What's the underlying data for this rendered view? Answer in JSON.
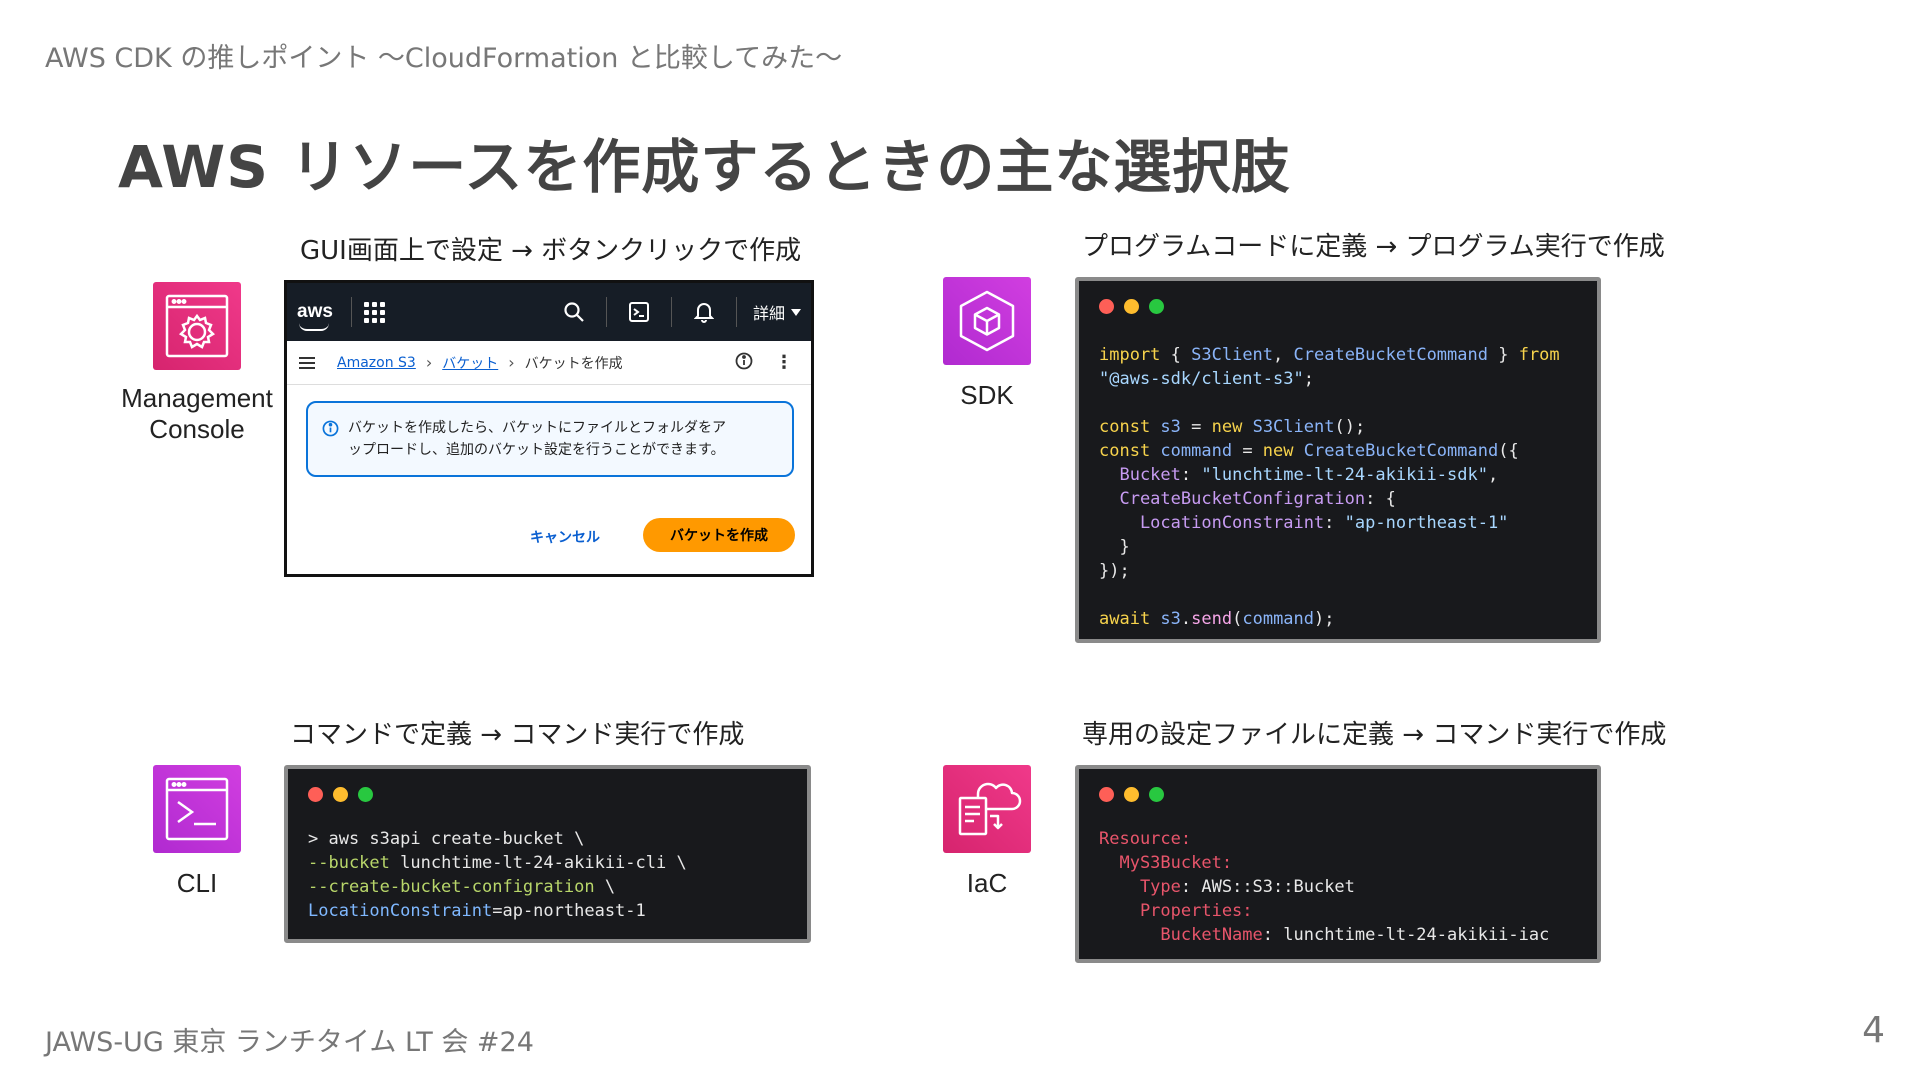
{
  "slide": {
    "header": "AWS CDK の推しポイント 〜CloudFormation と比較してみた〜",
    "title": "AWS リソースを作成するときの主な選択肢",
    "footer": "JAWS-UG 東京 ランチタイム LT 会 #24",
    "page_number": "4"
  },
  "quadrants": {
    "console": {
      "caption": "GUI画面上で設定 → ボタンクリックで作成",
      "label_line1": "Management",
      "label_line2": "Console",
      "icon": "gear-icon",
      "color": "#e7337f"
    },
    "sdk": {
      "caption": "プログラムコードに定義 → プログラム実行で作成",
      "label": "SDK",
      "icon": "cube-icon",
      "color": "#c93ad8"
    },
    "cli": {
      "caption": "コマンドで定義 → コマンド実行で作成",
      "label": "CLI",
      "icon": "terminal-prompt-icon",
      "color": "#c93ad8"
    },
    "iac": {
      "caption": "専用の設定ファイルに定義 → コマンド実行で作成",
      "label": "IaC",
      "icon": "cloud-document-icon",
      "color": "#e7337f"
    }
  },
  "console_mock": {
    "logo": "aws",
    "detail_menu": "詳細",
    "breadcrumb": [
      "Amazon S3",
      "バケット",
      "バケットを作成"
    ],
    "info_line1": "バケットを作成したら、バケットにファイルとフォルダをア",
    "info_line2": "ップロードし、追加のバケット設定を行うことができます。",
    "cancel_label": "キャンセル",
    "create_label": "バケットを作成"
  },
  "sdk_code": {
    "l1_import": "import",
    "l1_open": " { ",
    "l1_cls1": "S3Client",
    "l1_comma": ", ",
    "l1_cls2": "CreateBucketCommand",
    "l1_close": " } ",
    "l1_from": "from",
    "l2_str": "\"@aws-sdk/client-s3\"",
    "l2_semi": ";",
    "l4_const": "const",
    "l4_var": " s3",
    "l4_eq": " = ",
    "l4_new": "new",
    "l4_cls": " S3Client",
    "l4_rest": "();",
    "l5_const": "const",
    "l5_var": " command",
    "l5_eq": " = ",
    "l5_new": "new",
    "l5_cls": " CreateBucketCommand",
    "l5_rest": "({",
    "l6_prop": "  Bucket",
    "l6_colon": ": ",
    "l6_str": "\"lunchtime-lt-24-akikii-sdk\"",
    "l6_comma": ",",
    "l7_prop": "  CreateBucketConfigration",
    "l7_rest": ": {",
    "l8_prop": "    LocationConstraint",
    "l8_colon": ": ",
    "l8_str": "\"ap-northeast-1\"",
    "l9": "  }",
    "l10": "});",
    "l12_await": "await",
    "l12_obj": " s3",
    "l12_dot": ".",
    "l12_fn": "send",
    "l12_open": "(",
    "l12_arg": "command",
    "l12_close": ");"
  },
  "cli_code": {
    "l1": "> aws s3api create-bucket \\",
    "l2_flag": "--bucket",
    "l2_val": " lunchtime-lt-24-akikii-cli \\",
    "l3_flag": "--create-bucket-configration",
    "l3_val": " \\",
    "l4_key": "LocationConstraint",
    "l4_val": "=ap-northeast-1"
  },
  "iac_code": {
    "l1": "Resource:",
    "l2": "  MyS3Bucket:",
    "l3_key": "    Type",
    "l3_colon": ": ",
    "l3_val": "AWS::S3::Bucket",
    "l4": "    Properties:",
    "l5_key": "      BucketName",
    "l5_colon": ": ",
    "l5_val": "lunchtime-lt-24-akikii-iac"
  }
}
